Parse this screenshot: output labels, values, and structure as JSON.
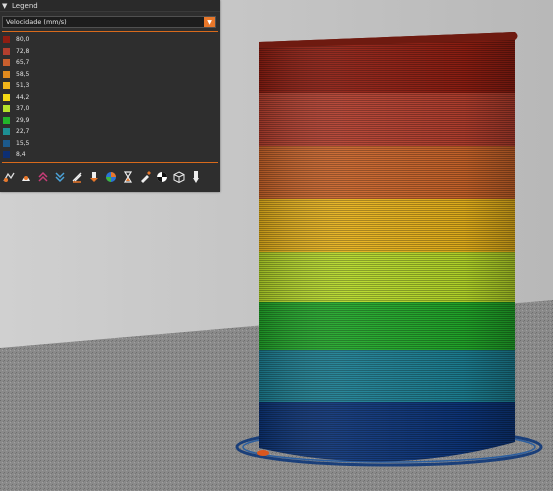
{
  "legend": {
    "title": "Legend",
    "selected_view": "Velocidade (mm/s)",
    "items": [
      {
        "label": "80,0",
        "color": "#8f1e12"
      },
      {
        "label": "72,8",
        "color": "#b33f2e"
      },
      {
        "label": "65,7",
        "color": "#c95f2e"
      },
      {
        "label": "58,5",
        "color": "#e08a1e"
      },
      {
        "label": "51,3",
        "color": "#f0b51a"
      },
      {
        "label": "44,2",
        "color": "#f3d914"
      },
      {
        "label": "37,0",
        "color": "#b6e32a"
      },
      {
        "label": "29,9",
        "color": "#22b52a"
      },
      {
        "label": "22,7",
        "color": "#1d8f93"
      },
      {
        "label": "15,5",
        "color": "#1c5a8c"
      },
      {
        "label": "8,4",
        "color": "#0d2f73"
      }
    ]
  },
  "toolbar": {
    "buttons": [
      "travel-moves-icon",
      "wipe-icon",
      "retractions-icon",
      "deretractions-icon",
      "seams-icon",
      "tool-changes-icon",
      "color-changes-icon",
      "pause-print-icon",
      "custom-gcode-icon",
      "center-of-gravity-icon",
      "shells-icon",
      "tool-marker-icon"
    ]
  },
  "accent_color": "#e8772a"
}
